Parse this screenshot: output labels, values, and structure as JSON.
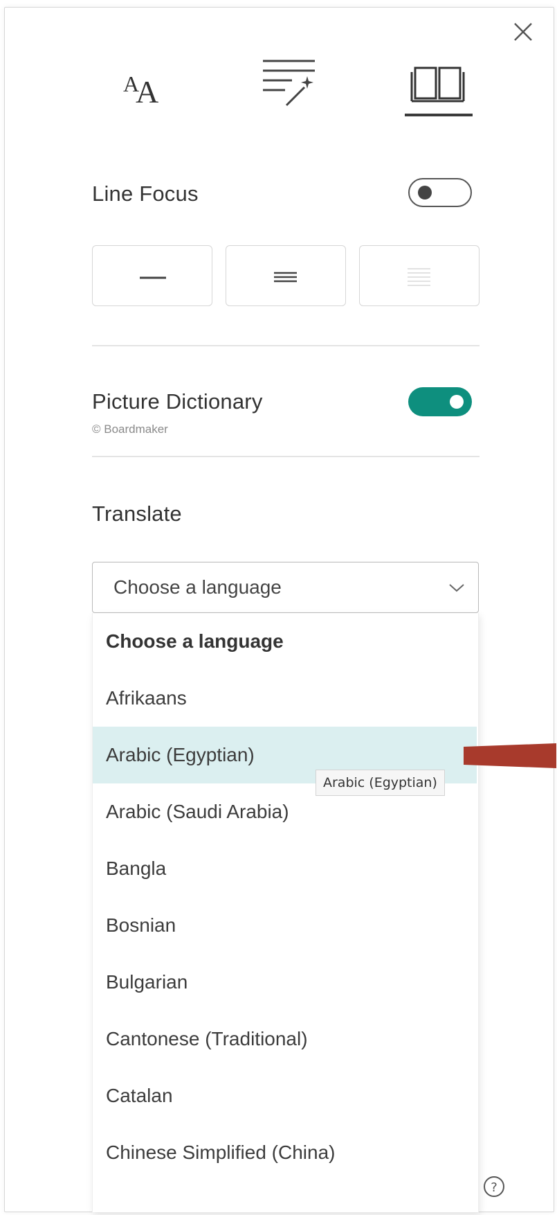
{
  "tabs": [
    {
      "name": "text-options",
      "icon": "text-size-icon"
    },
    {
      "name": "grammar-options",
      "icon": "grammar-magic-icon"
    },
    {
      "name": "reading-preferences",
      "icon": "book-icon",
      "selected": true
    }
  ],
  "line_focus": {
    "label": "Line Focus",
    "enabled": false,
    "options": [
      {
        "name": "one-line",
        "icon": "single-line-icon",
        "enabled": true
      },
      {
        "name": "three-lines",
        "icon": "three-lines-icon",
        "enabled": true
      },
      {
        "name": "five-lines",
        "icon": "five-lines-icon",
        "enabled": false
      }
    ]
  },
  "picture_dictionary": {
    "label": "Picture Dictionary",
    "credit": "© Boardmaker",
    "enabled": true
  },
  "translate": {
    "label": "Translate",
    "selected": "Choose a language",
    "options": [
      "Choose a language",
      "Afrikaans",
      "Arabic (Egyptian)",
      "Arabic (Saudi Arabia)",
      "Bangla",
      "Bosnian",
      "Bulgarian",
      "Cantonese (Traditional)",
      "Catalan",
      "Chinese Simplified (China)"
    ],
    "hovered_option": "Arabic (Egyptian)",
    "tooltip": "Arabic (Egyptian)"
  },
  "colors": {
    "accent": "#0e8f7e",
    "hover": "#dbeff0",
    "annotation_arrow": "#a83a2c"
  }
}
